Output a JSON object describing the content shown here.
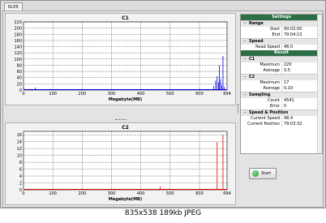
{
  "tab": {
    "label": "BLER"
  },
  "charts": [
    {
      "title": "C1",
      "xlabel": "Megabyte(MB)",
      "ylim": [
        0,
        220
      ],
      "yticks": [
        "0",
        "20",
        "40",
        "60",
        "80",
        "100",
        "120",
        "140",
        "160",
        "180",
        "200",
        "220"
      ],
      "xticks": [
        "0",
        "100",
        "200",
        "300",
        "400",
        "500",
        "600",
        "694"
      ],
      "color": "#0000e0",
      "peak_mb": 694
    },
    {
      "title": "C2",
      "xlabel": "Megabyte(MB)",
      "ylim": [
        0,
        17
      ],
      "yticks": [
        "0",
        "2",
        "4",
        "6",
        "8",
        "10",
        "12",
        "14",
        "16"
      ],
      "xticks": [
        "0",
        "100",
        "200",
        "300",
        "400",
        "500",
        "600",
        "694"
      ],
      "color": "#e00000",
      "peak_mb": 694
    }
  ],
  "chart_data": [
    {
      "type": "bar",
      "title": "C1",
      "xlabel": "Megabyte(MB)",
      "ylabel": "",
      "xlim": [
        0,
        694
      ],
      "ylim": [
        0,
        220
      ],
      "x": [
        2,
        25,
        40,
        120,
        180,
        250,
        300,
        370,
        480,
        560,
        600,
        648,
        655,
        660,
        665,
        668,
        672,
        676,
        680,
        684
      ],
      "values": [
        4,
        3,
        8,
        3,
        2,
        3,
        2,
        3,
        2,
        3,
        4,
        12,
        30,
        45,
        25,
        80,
        35,
        15,
        110,
        10
      ]
    },
    {
      "type": "bar",
      "title": "C2",
      "xlabel": "Megabyte(MB)",
      "ylabel": "",
      "xlim": [
        0,
        694
      ],
      "ylim": [
        0,
        17
      ],
      "x": [
        466,
        660,
        680
      ],
      "values": [
        1,
        14,
        16
      ]
    }
  ],
  "settings": {
    "title": "Settings",
    "range": {
      "label": "Range",
      "start_label": "Start",
      "start": "00:02:00",
      "end_label": "End",
      "end": "79:04:13"
    },
    "speed": {
      "label": "Speed",
      "read_label": "Read Speed",
      "read": "48,0"
    }
  },
  "result": {
    "title": "Result",
    "c1": {
      "label": "C1",
      "max_label": "Maximum",
      "max": "220",
      "avg_label": "Average",
      "avg": "0,5"
    },
    "c2": {
      "label": "C2",
      "max_label": "Maximum",
      "max": "17",
      "avg_label": "Average",
      "avg": "0,10"
    },
    "sampling": {
      "label": "Sampling",
      "count_label": "Count",
      "count": "4541",
      "error_label": "Error",
      "error": "0"
    },
    "speedpos": {
      "label": "Speed & Position",
      "speed_label": "Current Speed",
      "speed": "48,4",
      "pos_label": "Current Position",
      "pos": "79:03:32"
    }
  },
  "start_button": {
    "label": "Start"
  },
  "caption": "835x538  189kb  JPEG"
}
